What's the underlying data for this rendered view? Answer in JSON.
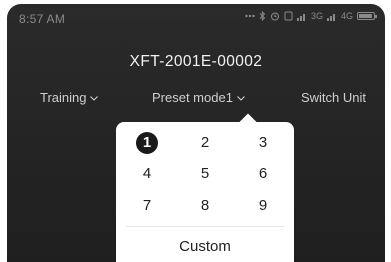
{
  "status_bar": {
    "time": "8:57 AM",
    "icons": [
      "more-dots-icon",
      "bluetooth-icon",
      "alarm-icon",
      "signal-icon",
      "network-3g-icon",
      "signal-icon",
      "network-4g-icon",
      "battery-icon"
    ],
    "network_3g": "3G",
    "network_4g": "4G"
  },
  "header": {
    "device_name": "XFT-2001E-00002"
  },
  "menu": {
    "training": "Training",
    "preset_mode": "Preset mode1",
    "switch_unit": "Switch Unit"
  },
  "dropdown": {
    "options": [
      "1",
      "2",
      "3",
      "4",
      "5",
      "6",
      "7",
      "8",
      "9"
    ],
    "selected": "1",
    "custom": "Custom"
  },
  "colors": {
    "background": "#262627",
    "title_text": "#f2f2f2",
    "menu_text": "#cfcfcf",
    "popup": "#ffffff",
    "selected_circle": "#1a1a1a"
  }
}
